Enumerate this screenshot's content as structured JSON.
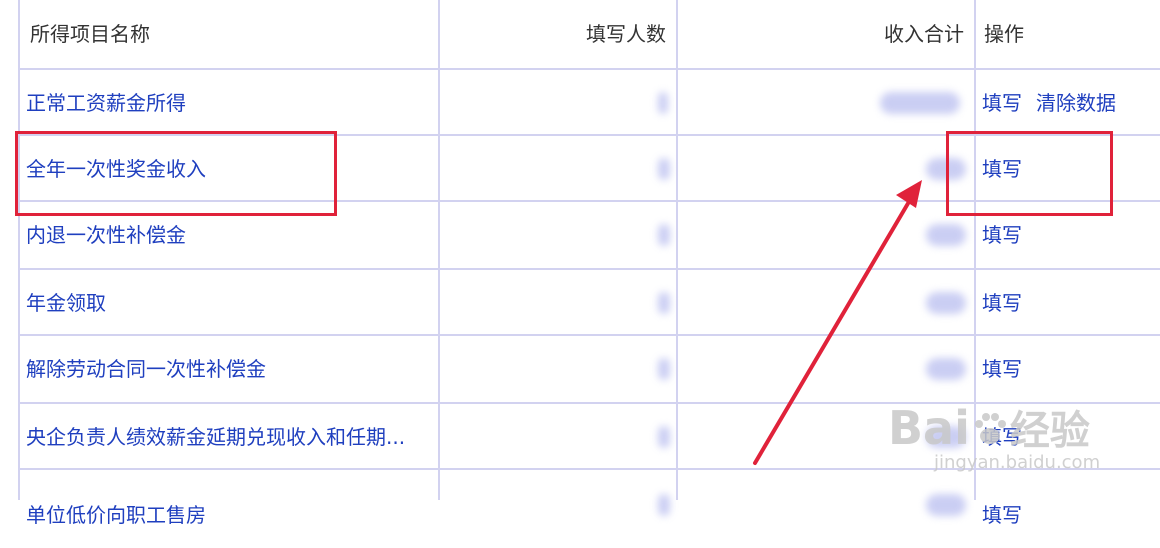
{
  "table": {
    "headers": {
      "name": "所得项目名称",
      "count": "填写人数",
      "income": "收入合计",
      "ops": "操作"
    },
    "rows": [
      {
        "name": "正常工资薪金所得",
        "ops": [
          "填写",
          "清除数据"
        ]
      },
      {
        "name": "全年一次性奖金收入",
        "ops": [
          "填写"
        ]
      },
      {
        "name": "内退一次性补偿金",
        "ops": [
          "填写"
        ]
      },
      {
        "name": "年金领取",
        "ops": [
          "填写"
        ]
      },
      {
        "name": "解除劳动合同一次性补偿金",
        "ops": [
          "填写"
        ]
      },
      {
        "name": "央企负责人绩效薪金延期兑现收入和任期...",
        "ops": [
          "填写"
        ]
      },
      {
        "name": "单位低价向职工售房",
        "ops": [
          "填写"
        ]
      }
    ]
  },
  "annotation": {
    "color": "#e0223a"
  },
  "watermark": {
    "brand": "Bai",
    "brand2": "经验",
    "url": "jingyan.baidu.com"
  }
}
